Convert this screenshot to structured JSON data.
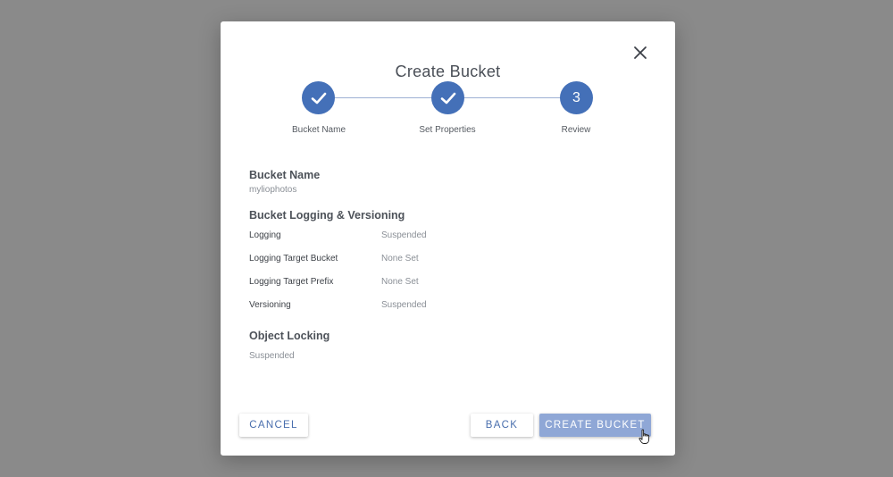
{
  "dialog": {
    "title": "Create Bucket"
  },
  "stepper": {
    "steps": [
      {
        "label": "Bucket Name",
        "state": "done"
      },
      {
        "label": "Set Properties",
        "state": "done"
      },
      {
        "label": "Review",
        "state": "current",
        "number": "3"
      }
    ]
  },
  "review": {
    "bucket_name_heading": "Bucket Name",
    "bucket_name_value": "myliophotos",
    "logging_heading": "Bucket Logging & Versioning",
    "rows": [
      {
        "label": "Logging",
        "value": "Suspended"
      },
      {
        "label": "Logging Target Bucket",
        "value": "None Set"
      },
      {
        "label": "Logging Target Prefix",
        "value": "None Set"
      },
      {
        "label": "Versioning",
        "value": "Suspended"
      }
    ],
    "object_locking_heading": "Object Locking",
    "object_locking_value": "Suspended"
  },
  "buttons": {
    "cancel": "CANCEL",
    "back": "BACK",
    "create": "CREATE BUCKET"
  },
  "colors": {
    "accent": "#4470b8",
    "primary_button": "#8fa7d6",
    "overlay": "#8a8a8a"
  },
  "icons": {
    "close": "close-icon",
    "done_step": "check-icon",
    "pointer": "hand-cursor-icon"
  }
}
